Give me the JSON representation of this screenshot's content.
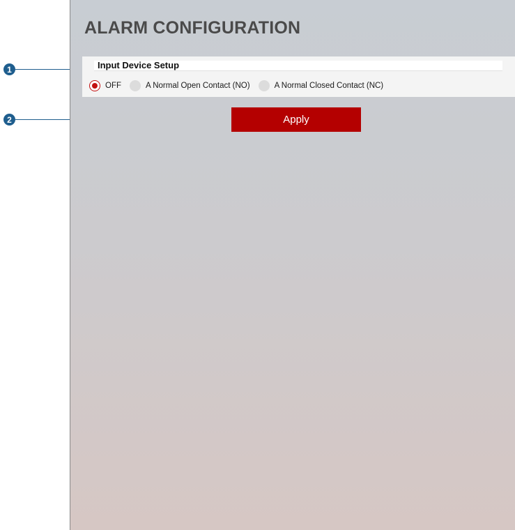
{
  "page": {
    "title": "ALARM CONFIGURATION"
  },
  "input_device_setup": {
    "section_title": "Input Device Setup",
    "options": [
      {
        "label": "OFF",
        "selected": true
      },
      {
        "label": "A Normal Open Contact (NO)",
        "selected": false
      },
      {
        "label": "A Normal Closed Contact (NC)",
        "selected": false
      }
    ]
  },
  "apply_button": {
    "label": "Apply"
  },
  "callouts": [
    {
      "number": "1"
    },
    {
      "number": "2"
    }
  ],
  "colors": {
    "accent": "#b40000",
    "callout": "#1f5e8e",
    "radio_selected": "#c21010"
  }
}
